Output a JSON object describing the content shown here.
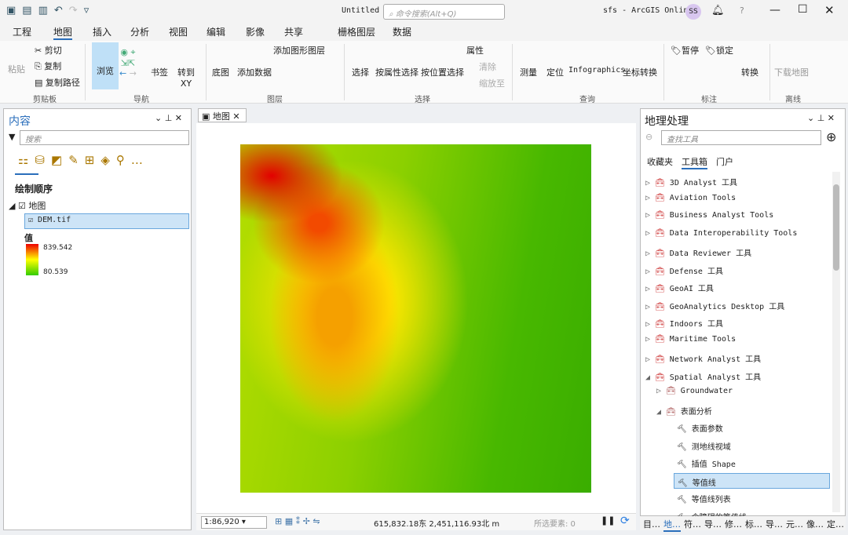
{
  "titlebar": {
    "doc": "Untitled",
    "search_placeholder": "命令搜索(Alt+Q)",
    "account": "sfs - ArcGIS Online",
    "avatar": "SS"
  },
  "tabs": [
    "工程",
    "地图",
    "插入",
    "分析",
    "视图",
    "编辑",
    "影像",
    "共享"
  ],
  "context_tabs": [
    "栅格图层",
    "数据"
  ],
  "ribbon": {
    "paste": "粘贴",
    "cut": "剪切",
    "copy": "复制",
    "copy_path": "复制路径",
    "clipboard": "剪贴板",
    "explore": "浏览",
    "bookmarks": "书签",
    "goto": "转到XY",
    "navigate": "导航",
    "basemap": "底图",
    "add_data": "添加数据",
    "add_graphics": "添加图形图层",
    "layer": "图层",
    "select": "选择",
    "select_attr": "按属性选择",
    "select_loc": "按位置选择",
    "attributes": "属性",
    "clear": "清除",
    "zoom_to": "缩放至",
    "selection": "选择",
    "measure": "测量",
    "locate": "定位",
    "infographics": "Infographics",
    "convert_coord": "坐标转换",
    "inquiry": "查询",
    "pause": "暂停",
    "lock": "锁定",
    "convert": "转换",
    "labeling": "标注",
    "download_map": "下载地图",
    "offline": "离线"
  },
  "contents": {
    "title": "内容",
    "search_placeholder": "搜索",
    "drawing_order": "绘制顺序",
    "map": "地图",
    "layer": "DEM.tif",
    "value_label": "值",
    "max": "839.542",
    "min": "80.539"
  },
  "map_tab": "地图",
  "status": {
    "scale": "1:86,920",
    "coords": "615,832.18东 2,451,116.93北 m",
    "selected": "所选要素: 0"
  },
  "geoprocessing": {
    "title": "地理处理",
    "search_placeholder": "查找工具",
    "tabs": [
      "收藏夹",
      "工具箱",
      "门户"
    ],
    "toolboxes": [
      "3D Analyst 工具",
      "Aviation Tools",
      "Business Analyst Tools",
      "Data Interoperability Tools",
      "Data Reviewer 工具",
      "Defense 工具",
      "GeoAI 工具",
      "GeoAnalytics Desktop 工具",
      "Indoors 工具",
      "Maritime Tools",
      "Network Analyst 工具",
      "Spatial Analyst 工具"
    ],
    "sub": [
      "Groundwater",
      "表面分析"
    ],
    "tools": [
      "表面参数",
      "测地线视域",
      "插值 Shape",
      "等值线",
      "等值线列表",
      "含障碍的等值线"
    ],
    "selected_tool": "等值线"
  },
  "bottom_tabs": [
    "目…",
    "地…",
    "符…",
    "导…",
    "修…",
    "标…",
    "导…",
    "元…",
    "像…",
    "定…"
  ]
}
